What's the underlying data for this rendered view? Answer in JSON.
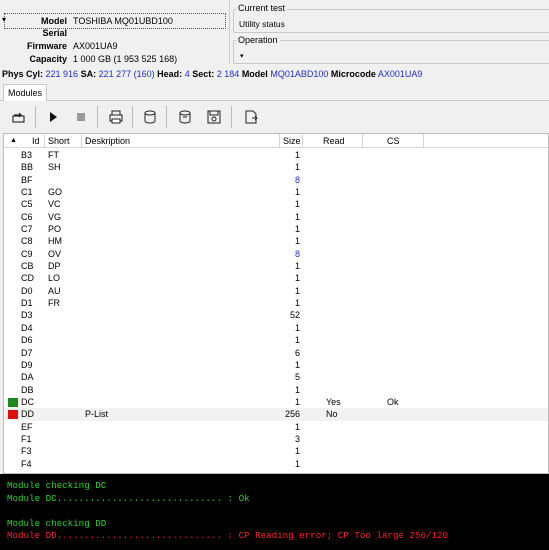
{
  "info": {
    "model_label": "Model",
    "model_value": "TOSHIBA MQ01UBD100",
    "serial_label": "Serial",
    "serial_value": "",
    "firmware_label": "Firmware",
    "firmware_value": "AX001UA9",
    "capacity_label": "Capacity",
    "capacity_value": "1 000 GB (1 953 525 168)"
  },
  "current_test": {
    "title": "Current test",
    "value": "Utility status"
  },
  "operation": {
    "title": "Operation",
    "value": ""
  },
  "params": {
    "phys_cyl_label": "Phys Cyl:",
    "phys_cyl_value": "221 916",
    "sa_label": "SA:",
    "sa_value": "221 277 (160)",
    "head_label": "Head:",
    "head_value": "4",
    "sect_label": "Sect:",
    "sect_value": "2 184",
    "model_label": "Model",
    "model_value": "MQ01ABD100",
    "microcode_label": "Microcode",
    "microcode_value": "AX001UA9"
  },
  "tabs": [
    {
      "label": "Modules"
    }
  ],
  "toolbar": {
    "icons": [
      "refresh-icon",
      "play-icon",
      "stop-icon",
      "print-icon",
      "drive-icon",
      "drive-read-icon",
      "drive-save-icon",
      "export-icon"
    ]
  },
  "table": {
    "columns": {
      "id": "Id",
      "short": "Short",
      "desc": "Deskription",
      "size": "Size",
      "read": "Read",
      "cs": "CS"
    },
    "rows": [
      {
        "id": "B3",
        "short": "FT",
        "desc": "",
        "size": "1",
        "read": "",
        "cs": "",
        "mark": "",
        "size_color": ""
      },
      {
        "id": "BB",
        "short": "SH",
        "desc": "",
        "size": "1",
        "read": "",
        "cs": "",
        "mark": "",
        "size_color": ""
      },
      {
        "id": "BF",
        "short": "",
        "desc": "",
        "size": "8",
        "read": "",
        "cs": "",
        "mark": "",
        "size_color": "blue"
      },
      {
        "id": "C1",
        "short": "GO",
        "desc": "",
        "size": "1",
        "read": "",
        "cs": "",
        "mark": "",
        "size_color": ""
      },
      {
        "id": "C5",
        "short": "VC",
        "desc": "",
        "size": "1",
        "read": "",
        "cs": "",
        "mark": "",
        "size_color": ""
      },
      {
        "id": "C6",
        "short": "VG",
        "desc": "",
        "size": "1",
        "read": "",
        "cs": "",
        "mark": "",
        "size_color": ""
      },
      {
        "id": "C7",
        "short": "PO",
        "desc": "",
        "size": "1",
        "read": "",
        "cs": "",
        "mark": "",
        "size_color": ""
      },
      {
        "id": "C8",
        "short": "HM",
        "desc": "",
        "size": "1",
        "read": "",
        "cs": "",
        "mark": "",
        "size_color": ""
      },
      {
        "id": "C9",
        "short": "OV",
        "desc": "",
        "size": "8",
        "read": "",
        "cs": "",
        "mark": "",
        "size_color": "blue"
      },
      {
        "id": "CB",
        "short": "DP",
        "desc": "",
        "size": "1",
        "read": "",
        "cs": "",
        "mark": "",
        "size_color": ""
      },
      {
        "id": "CD",
        "short": "LO",
        "desc": "",
        "size": "1",
        "read": "",
        "cs": "",
        "mark": "",
        "size_color": ""
      },
      {
        "id": "D0",
        "short": "AU",
        "desc": "",
        "size": "1",
        "read": "",
        "cs": "",
        "mark": "",
        "size_color": ""
      },
      {
        "id": "D1",
        "short": "FR",
        "desc": "",
        "size": "1",
        "read": "",
        "cs": "",
        "mark": "",
        "size_color": ""
      },
      {
        "id": "D3",
        "short": "",
        "desc": "",
        "size": "52",
        "read": "",
        "cs": "",
        "mark": "",
        "size_color": ""
      },
      {
        "id": "D4",
        "short": "",
        "desc": "",
        "size": "1",
        "read": "",
        "cs": "",
        "mark": "",
        "size_color": ""
      },
      {
        "id": "D6",
        "short": "",
        "desc": "",
        "size": "1",
        "read": "",
        "cs": "",
        "mark": "",
        "size_color": ""
      },
      {
        "id": "D7",
        "short": "",
        "desc": "",
        "size": "6",
        "read": "",
        "cs": "",
        "mark": "",
        "size_color": ""
      },
      {
        "id": "D9",
        "short": "",
        "desc": "",
        "size": "1",
        "read": "",
        "cs": "",
        "mark": "",
        "size_color": ""
      },
      {
        "id": "DA",
        "short": "",
        "desc": "",
        "size": "5",
        "read": "",
        "cs": "",
        "mark": "",
        "size_color": ""
      },
      {
        "id": "DB",
        "short": "",
        "desc": "",
        "size": "1",
        "read": "",
        "cs": "",
        "mark": "",
        "size_color": ""
      },
      {
        "id": "DC",
        "short": "",
        "desc": "",
        "size": "1",
        "read": "Yes",
        "cs": "Ok",
        "mark": "green",
        "size_color": ""
      },
      {
        "id": "DD",
        "short": "",
        "desc": "P-List",
        "size": "256",
        "read": "No",
        "cs": "",
        "mark": "red",
        "size_color": ""
      },
      {
        "id": "EF",
        "short": "",
        "desc": "",
        "size": "1",
        "read": "",
        "cs": "",
        "mark": "",
        "size_color": ""
      },
      {
        "id": "F1",
        "short": "",
        "desc": "",
        "size": "3",
        "read": "",
        "cs": "",
        "mark": "",
        "size_color": ""
      },
      {
        "id": "F3",
        "short": "",
        "desc": "",
        "size": "1",
        "read": "",
        "cs": "",
        "mark": "",
        "size_color": ""
      },
      {
        "id": "F4",
        "short": "",
        "desc": "",
        "size": "1",
        "read": "",
        "cs": "",
        "mark": "",
        "size_color": ""
      }
    ],
    "selected_row": 21
  },
  "console": {
    "lines": [
      {
        "text": "Module checking DC",
        "color": "green"
      },
      {
        "text": "Module DC.............................. : Ok",
        "color": "green"
      },
      {
        "text": "",
        "color": "green"
      },
      {
        "text": "Module checking DD",
        "color": "green"
      },
      {
        "text": "Module DD.............................. : CP Reading error; CP Too large 256/120",
        "color": "red"
      }
    ]
  },
  "colors": {
    "accent_blue": "#1e2fc8",
    "ok_green": "#1d8a1d",
    "err_red": "#e01010",
    "console_green": "#2bd42b",
    "console_red": "#ff2424"
  }
}
